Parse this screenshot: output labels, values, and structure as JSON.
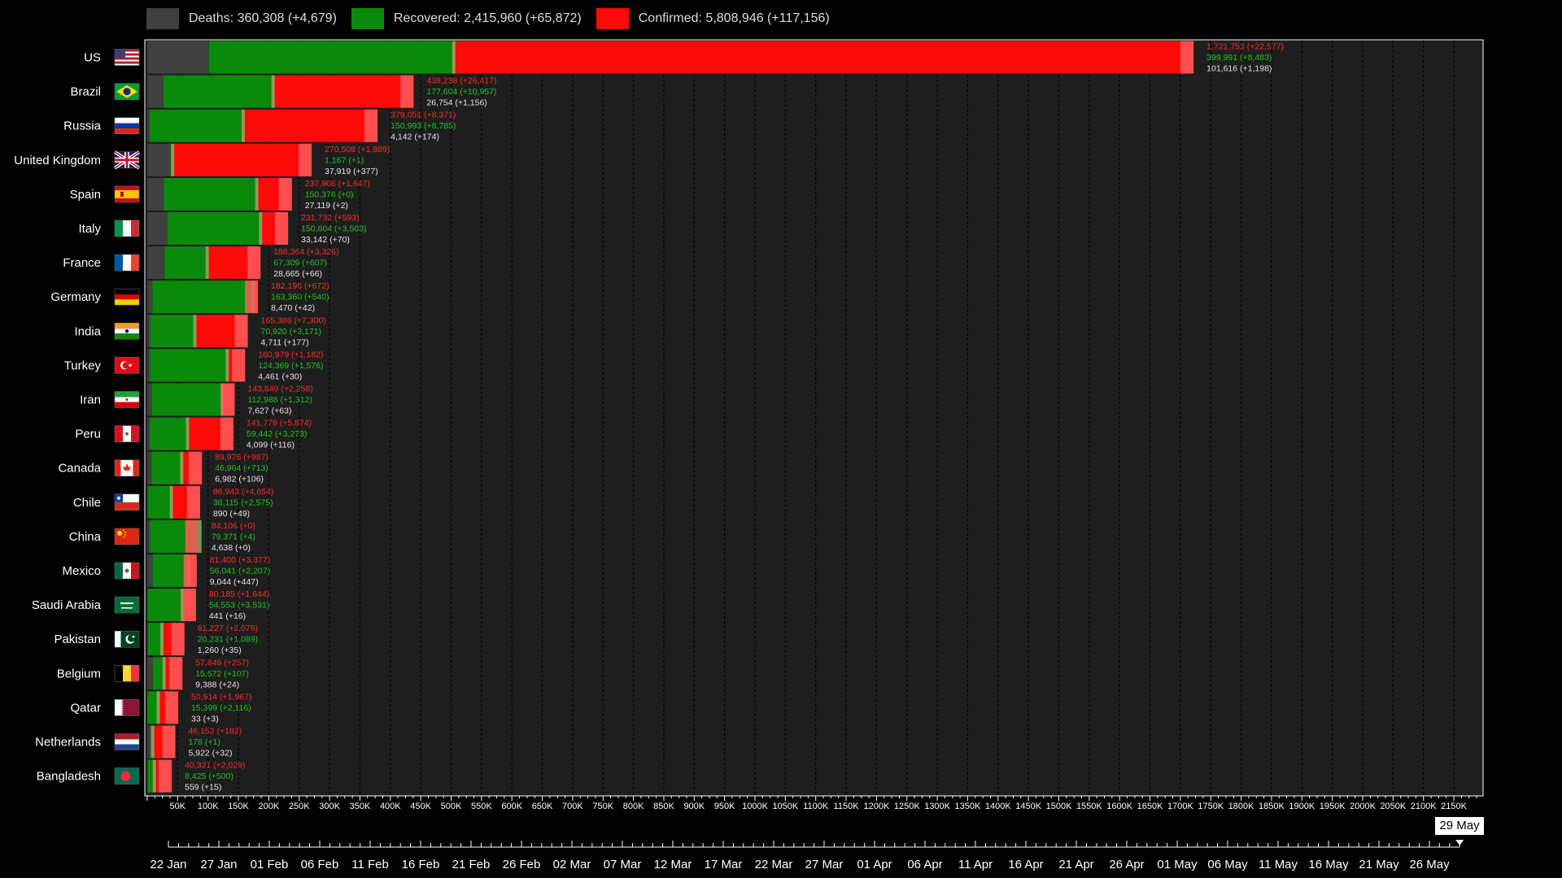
{
  "colors": {
    "deaths": "#404040",
    "recovered": "#0a8a0a",
    "confirmed": "#ff0a0a",
    "background": "#000000",
    "plot": "#1e1e1e"
  },
  "legend": [
    {
      "key": "deaths",
      "label": "Deaths: 360,308 (+4,679)"
    },
    {
      "key": "recovered",
      "label": "Recovered: 2,415,960 (+65,872)"
    },
    {
      "key": "confirmed",
      "label": "Confirmed: 5,808,946 (+117,156)"
    }
  ],
  "current_date": "29 May",
  "chart_data": {
    "type": "bar",
    "orientation": "horizontal-stacked",
    "xlim": [
      0,
      2200000
    ],
    "x_ticks": [
      "50K",
      "100K",
      "150K",
      "200K",
      "250K",
      "300K",
      "350K",
      "400K",
      "450K",
      "500K",
      "550K",
      "600K",
      "650K",
      "700K",
      "750K",
      "800K",
      "850K",
      "900K",
      "950K",
      "1000K",
      "1050K",
      "1100K",
      "1150K",
      "1200K",
      "1250K",
      "1300K",
      "1350K",
      "1400K",
      "1450K",
      "1500K",
      "1550K",
      "1600K",
      "1650K",
      "1700K",
      "1750K",
      "1800K",
      "1850K",
      "1900K",
      "1950K",
      "2000K",
      "2050K",
      "2100K",
      "2150K"
    ],
    "timeline_labels": [
      "22 Jan",
      "27 Jan",
      "01 Feb",
      "06 Feb",
      "11 Feb",
      "16 Feb",
      "21 Feb",
      "26 Feb",
      "02 Mar",
      "07 Mar",
      "12 Mar",
      "17 Mar",
      "22 Mar",
      "27 Mar",
      "01 Apr",
      "06 Apr",
      "11 Apr",
      "16 Apr",
      "21 Apr",
      "26 Apr",
      "01 May",
      "06 May",
      "11 May",
      "16 May",
      "21 May",
      "26 May"
    ],
    "rows": [
      {
        "country": "US",
        "flag": "us",
        "confirmed": 1721753,
        "recovered": 399991,
        "deaths": 101616,
        "confirmed_label": "1,721,753 (+22,577)",
        "recovered_label": "399,991 (+8,483)",
        "deaths_label": "101,616 (+1,198)"
      },
      {
        "country": "Brazil",
        "flag": "brazil",
        "confirmed": 438238,
        "recovered": 177604,
        "deaths": 26754,
        "confirmed_label": "438,238 (+26,417)",
        "recovered_label": "177,604 (+10,957)",
        "deaths_label": "26,754 (+1,156)"
      },
      {
        "country": "Russia",
        "flag": "russia",
        "confirmed": 379051,
        "recovered": 150993,
        "deaths": 4142,
        "confirmed_label": "379,051 (+8,371)",
        "recovered_label": "150,993 (+8,785)",
        "deaths_label": "4,142 (+174)"
      },
      {
        "country": "United Kingdom",
        "flag": "uk",
        "confirmed": 270508,
        "recovered": 1167,
        "deaths": 37919,
        "confirmed_label": "270,508 (+1,889)",
        "recovered_label": "1,167 (+1)",
        "deaths_label": "37,919 (+377)"
      },
      {
        "country": "Spain",
        "flag": "spain",
        "confirmed": 237906,
        "recovered": 150376,
        "deaths": 27119,
        "confirmed_label": "237,906 (+1,647)",
        "recovered_label": "150,376 (+0)",
        "deaths_label": "27,119 (+2)"
      },
      {
        "country": "Italy",
        "flag": "italy",
        "confirmed": 231732,
        "recovered": 150604,
        "deaths": 33142,
        "confirmed_label": "231,732 (+593)",
        "recovered_label": "150,604 (+3,503)",
        "deaths_label": "33,142 (+70)"
      },
      {
        "country": "France",
        "flag": "france",
        "confirmed": 186364,
        "recovered": 67309,
        "deaths": 28665,
        "confirmed_label": "186,364 (+3,326)",
        "recovered_label": "67,309 (+607)",
        "deaths_label": "28,665 (+66)"
      },
      {
        "country": "Germany",
        "flag": "germany",
        "confirmed": 182196,
        "recovered": 163360,
        "deaths": 8470,
        "confirmed_label": "182,196 (+672)",
        "recovered_label": "163,360 (+540)",
        "deaths_label": "8,470 (+42)"
      },
      {
        "country": "India",
        "flag": "india",
        "confirmed": 165386,
        "recovered": 70920,
        "deaths": 4711,
        "confirmed_label": "165,386 (+7,300)",
        "recovered_label": "70,920 (+3,171)",
        "deaths_label": "4,711 (+177)"
      },
      {
        "country": "Turkey",
        "flag": "turkey",
        "confirmed": 160979,
        "recovered": 124369,
        "deaths": 4461,
        "confirmed_label": "160,979 (+1,182)",
        "recovered_label": "124,369 (+1,576)",
        "deaths_label": "4,461 (+30)"
      },
      {
        "country": "Iran",
        "flag": "iran",
        "confirmed": 143849,
        "recovered": 112988,
        "deaths": 7627,
        "confirmed_label": "143,849 (+2,258)",
        "recovered_label": "112,988 (+1,312)",
        "deaths_label": "7,627 (+63)"
      },
      {
        "country": "Peru",
        "flag": "peru",
        "confirmed": 141779,
        "recovered": 59442,
        "deaths": 4099,
        "confirmed_label": "141,779 (+5,874)",
        "recovered_label": "59,442 (+3,273)",
        "deaths_label": "4,099 (+116)"
      },
      {
        "country": "Canada",
        "flag": "canada",
        "confirmed": 89976,
        "recovered": 46964,
        "deaths": 6982,
        "confirmed_label": "89,976 (+987)",
        "recovered_label": "46,964 (+713)",
        "deaths_label": "6,982 (+106)"
      },
      {
        "country": "Chile",
        "flag": "chile",
        "confirmed": 86943,
        "recovered": 36115,
        "deaths": 890,
        "confirmed_label": "86,943 (+4,654)",
        "recovered_label": "36,115 (+2,575)",
        "deaths_label": "890 (+49)"
      },
      {
        "country": "China",
        "flag": "china",
        "confirmed": 84106,
        "recovered": 79371,
        "deaths": 4638,
        "confirmed_label": "84,106 (+0)",
        "recovered_label": "79,371 (+4)",
        "deaths_label": "4,638 (+0)"
      },
      {
        "country": "Mexico",
        "flag": "mexico",
        "confirmed": 81400,
        "recovered": 56041,
        "deaths": 9044,
        "confirmed_label": "81,400 (+3,377)",
        "recovered_label": "56,041 (+2,207)",
        "deaths_label": "9,044 (+447)"
      },
      {
        "country": "Saudi Arabia",
        "flag": "saudi",
        "confirmed": 80185,
        "recovered": 54553,
        "deaths": 441,
        "confirmed_label": "80,185 (+1,644)",
        "recovered_label": "54,553 (+3,531)",
        "deaths_label": "441 (+16)"
      },
      {
        "country": "Pakistan",
        "flag": "pakistan",
        "confirmed": 61227,
        "recovered": 20231,
        "deaths": 1260,
        "confirmed_label": "61,227 (+2,076)",
        "recovered_label": "20,231 (+1,089)",
        "deaths_label": "1,260 (+35)"
      },
      {
        "country": "Belgium",
        "flag": "belgium",
        "confirmed": 57849,
        "recovered": 15572,
        "deaths": 9388,
        "confirmed_label": "57,849 (+257)",
        "recovered_label": "15,572 (+107)",
        "deaths_label": "9,388 (+24)"
      },
      {
        "country": "Qatar",
        "flag": "qatar",
        "confirmed": 50914,
        "recovered": 15399,
        "deaths": 33,
        "confirmed_label": "50,914 (+1,967)",
        "recovered_label": "15,399 (+2,116)",
        "deaths_label": "33 (+3)"
      },
      {
        "country": "Netherlands",
        "flag": "netherlands",
        "confirmed": 46152,
        "recovered": 178,
        "deaths": 5922,
        "confirmed_label": "46,152 (+182)",
        "recovered_label": "178 (+1)",
        "deaths_label": "5,922 (+32)"
      },
      {
        "country": "Bangladesh",
        "flag": "bangladesh",
        "confirmed": 40321,
        "recovered": 8425,
        "deaths": 559,
        "confirmed_label": "40,321 (+2,029)",
        "recovered_label": "8,425 (+500)",
        "deaths_label": "559 (+15)"
      }
    ]
  }
}
